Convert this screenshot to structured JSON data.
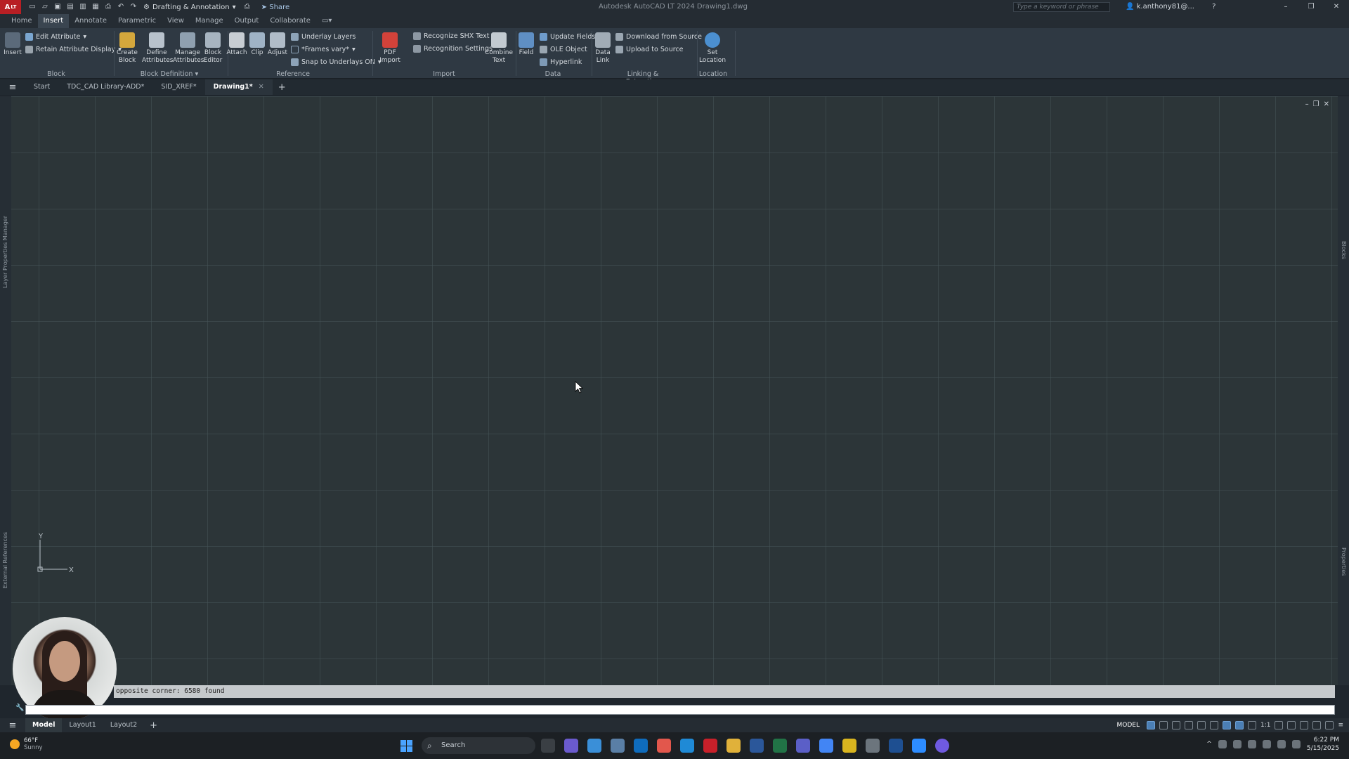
{
  "titlebar": {
    "app_logo": "A",
    "app_logo_suffix": "LT",
    "workspace": "Drafting & Annotation",
    "share": "Share",
    "title": "Autodesk AutoCAD LT 2024   Drawing1.dwg",
    "search_placeholder": "Type a keyword or phrase",
    "user": "k.anthony81@..."
  },
  "ribbon_tabs": [
    "Home",
    "Insert",
    "Annotate",
    "Parametric",
    "View",
    "Manage",
    "Output",
    "Collaborate"
  ],
  "ribbon": {
    "insert": "Insert",
    "edit_attribute": "Edit Attribute",
    "retain_attribute_display": "Retain Attribute Display",
    "create_block": [
      "Create",
      "Block"
    ],
    "define_attributes": [
      "Define",
      "Attributes"
    ],
    "manage_attributes": [
      "Manage",
      "Attributes"
    ],
    "block_editor": [
      "Block",
      "Editor"
    ],
    "attach": "Attach",
    "clip": "Clip",
    "adjust": "Adjust",
    "underlay_layers": "Underlay Layers",
    "frames_vary": "*Frames vary*",
    "snap_to_underlays": "Snap to Underlays ON",
    "pdf_import": [
      "PDF",
      "Import"
    ],
    "recognize_shx": "Recognize SHX Text",
    "recognition_settings": "Recognition Settings",
    "combine_text": [
      "Combine",
      "Text"
    ],
    "field": "Field",
    "update_fields": "Update Fields",
    "ole_object": "OLE Object",
    "hyperlink": "Hyperlink",
    "data_link": [
      "Data",
      "Link"
    ],
    "download_from_source": "Download from Source",
    "upload_to_source": "Upload to Source",
    "set_location": [
      "Set",
      "Location"
    ],
    "panels": {
      "block": "Block",
      "block_definition": "Block Definition",
      "reference": "Reference",
      "import": "Import",
      "data": "Data",
      "linking": "Linking & Extraction",
      "location": "Location"
    }
  },
  "doc_tabs": [
    "Start",
    "TDC_CAD Library-ADD*",
    "SID_XREF*",
    "Drawing1*"
  ],
  "side_labels": {
    "left_top": "Layer Properties Manager",
    "left_bottom": "External References",
    "right_top": "Blocks",
    "right_bottom": "Properties"
  },
  "ucs": {
    "y": "Y",
    "x": "X"
  },
  "command": {
    "history": "opposite corner: 6580 found"
  },
  "layout_tabs": [
    "Model",
    "Layout1",
    "Layout2"
  ],
  "status": {
    "mode": "MODEL",
    "scale": "1:1"
  },
  "taskbar": {
    "weather_temp": "66°F",
    "weather_cond": "Sunny",
    "search": "Search",
    "time": "6:22 PM",
    "date": "5/15/2025"
  },
  "colors": {
    "accent": "#4b7fb5",
    "canvas": "#2c3538",
    "ribbon": "#2f3943"
  }
}
